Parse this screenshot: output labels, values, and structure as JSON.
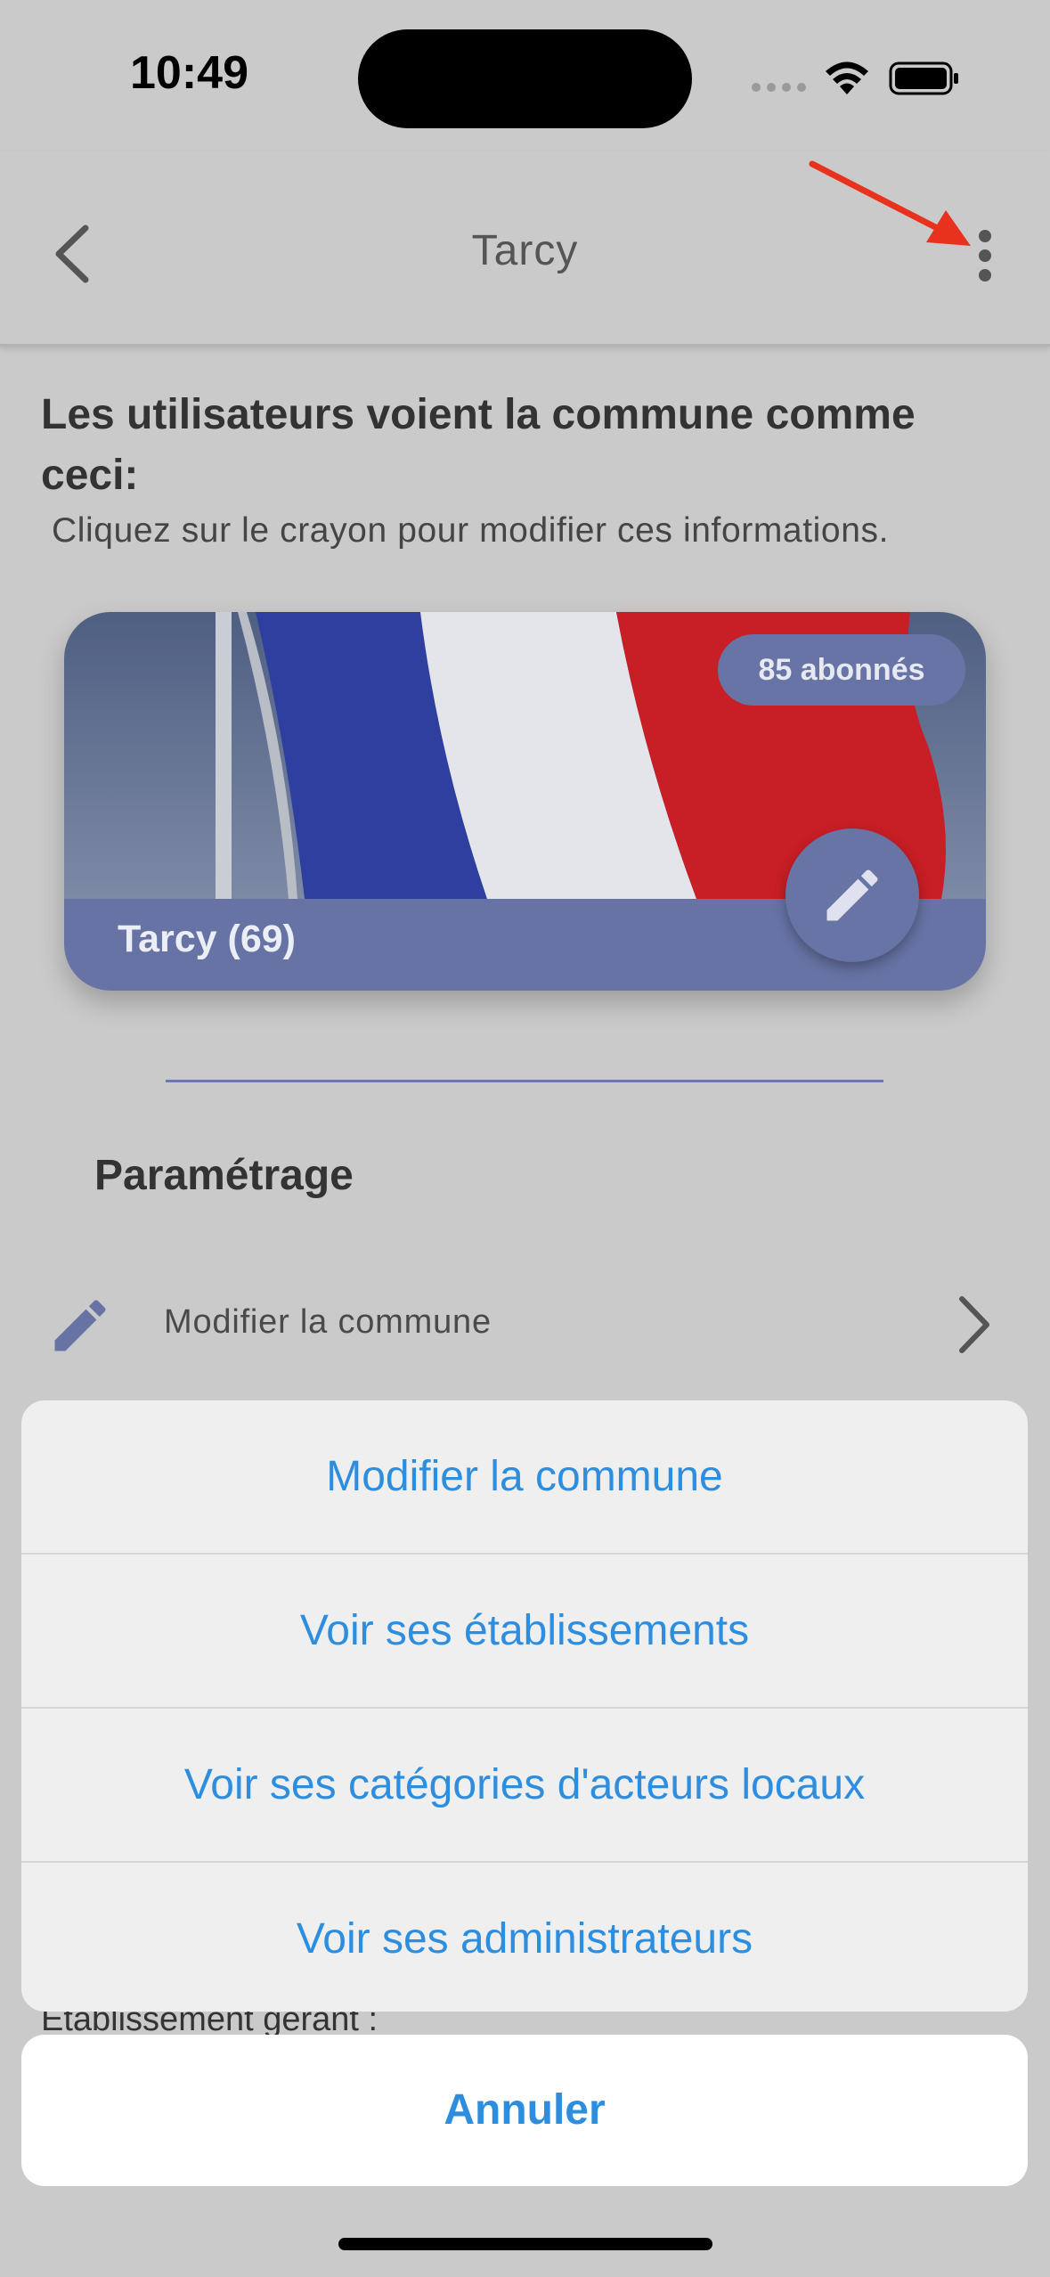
{
  "status_bar": {
    "time": "10:49"
  },
  "nav": {
    "title": "Tarcy"
  },
  "intro": {
    "heading": "Les utilisateurs voient la commune comme ceci:",
    "subheading": "Cliquez sur le crayon pour modifier ces informations."
  },
  "card": {
    "name": "Tarcy (69)",
    "subscribers": "85 abonnés",
    "image": "french-flag-photo"
  },
  "settings": {
    "section_title": "Paramétrage",
    "rows": [
      {
        "label": "Modifier la commune",
        "icon": "pencil-icon"
      }
    ],
    "peek_label": "Établissement gérant :"
  },
  "action_sheet": {
    "items": [
      "Modifier la commune",
      "Voir ses établissements",
      "Voir ses catégories d'acteurs locaux",
      "Voir ses administrateurs"
    ],
    "cancel": "Annuler"
  },
  "colors": {
    "accent": "#6874a6",
    "action_blue": "#2d8ee0",
    "annotation_arrow": "#e8321e"
  }
}
